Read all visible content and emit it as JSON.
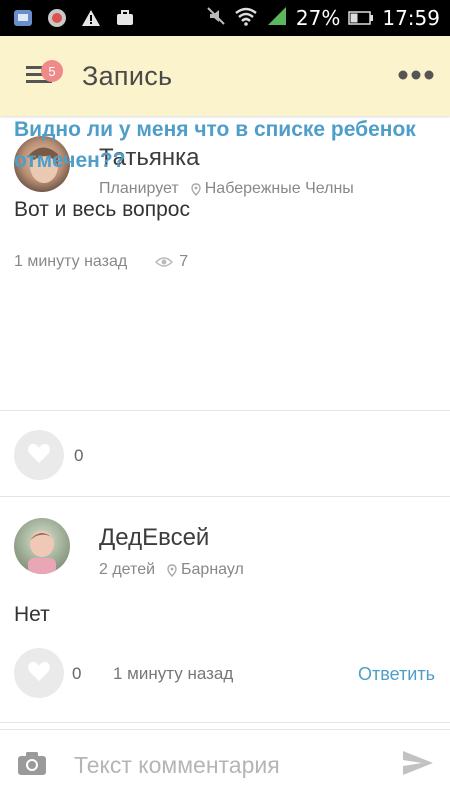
{
  "status_bar": {
    "battery_percent": "27%",
    "time": "17:59",
    "icons": [
      "app-icon",
      "app-icon",
      "warning-icon",
      "briefcase-icon",
      "mute-icon",
      "wifi-icon",
      "signal-icon",
      "battery-icon"
    ]
  },
  "app_bar": {
    "title": "Запись",
    "menu_badge": "5",
    "menu_icon": "hamburger-icon",
    "more_icon": "more-dots-icon"
  },
  "post": {
    "author_name": "Татьянка",
    "author_status": "Планирует",
    "author_location": "Набережные Челны",
    "title": "Видно ли у меня что в списке ребенок отмечен??",
    "body": "Вот и весь вопрос",
    "time": "1 минуту назад",
    "views": "7",
    "likes": "0"
  },
  "comment": {
    "author_name": "ДедЕвсей",
    "author_status": "2 детей",
    "author_location": "Барнаул",
    "text": "Нет",
    "likes": "0",
    "time": "1 минуту назад",
    "reply_label": "Ответить"
  },
  "comment_input": {
    "placeholder": "Текст комментария"
  },
  "colors": {
    "app_bar_bg": "#fbf3cc",
    "accent_link": "#4f9ec9",
    "badge": "#f08a8a"
  }
}
